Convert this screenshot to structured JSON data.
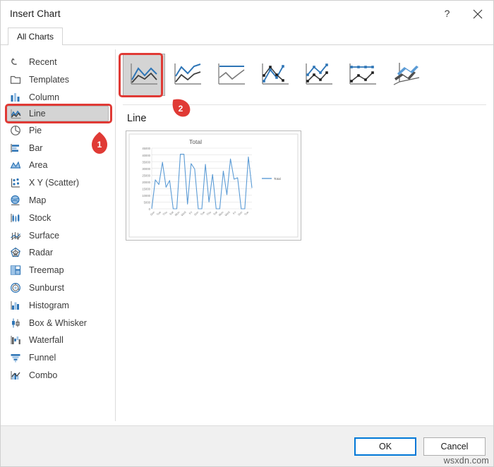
{
  "window": {
    "title": "Insert Chart",
    "help_button": "?",
    "close_button": "✕",
    "help_icon": "help-icon",
    "close_icon": "close-icon"
  },
  "tabs": [
    {
      "label": "All Charts",
      "selected": true
    }
  ],
  "sidebar": {
    "items": [
      {
        "label": "Recent",
        "icon": "recent-icon",
        "selected": false
      },
      {
        "label": "Templates",
        "icon": "templates-icon",
        "selected": false
      },
      {
        "label": "Column",
        "icon": "column-chart-icon",
        "selected": false
      },
      {
        "label": "Line",
        "icon": "line-chart-icon",
        "selected": true
      },
      {
        "label": "Pie",
        "icon": "pie-chart-icon",
        "selected": false
      },
      {
        "label": "Bar",
        "icon": "bar-chart-icon",
        "selected": false
      },
      {
        "label": "Area",
        "icon": "area-chart-icon",
        "selected": false
      },
      {
        "label": "X Y (Scatter)",
        "icon": "scatter-chart-icon",
        "selected": false
      },
      {
        "label": "Map",
        "icon": "map-chart-icon",
        "selected": false
      },
      {
        "label": "Stock",
        "icon": "stock-chart-icon",
        "selected": false
      },
      {
        "label": "Surface",
        "icon": "surface-chart-icon",
        "selected": false
      },
      {
        "label": "Radar",
        "icon": "radar-chart-icon",
        "selected": false
      },
      {
        "label": "Treemap",
        "icon": "treemap-chart-icon",
        "selected": false
      },
      {
        "label": "Sunburst",
        "icon": "sunburst-chart-icon",
        "selected": false
      },
      {
        "label": "Histogram",
        "icon": "histogram-chart-icon",
        "selected": false
      },
      {
        "label": "Box & Whisker",
        "icon": "box-whisker-icon",
        "selected": false
      },
      {
        "label": "Waterfall",
        "icon": "waterfall-chart-icon",
        "selected": false
      },
      {
        "label": "Funnel",
        "icon": "funnel-chart-icon",
        "selected": false
      },
      {
        "label": "Combo",
        "icon": "combo-chart-icon",
        "selected": false
      }
    ]
  },
  "main": {
    "type_heading": "Line",
    "thumbnails": [
      {
        "name": "line",
        "selected": true
      },
      {
        "name": "stacked-line",
        "selected": false
      },
      {
        "name": "100-percent-stacked-line",
        "selected": false
      },
      {
        "name": "line-with-markers",
        "selected": false
      },
      {
        "name": "stacked-line-with-markers",
        "selected": false
      },
      {
        "name": "100-percent-stacked-line-with-markers",
        "selected": false
      },
      {
        "name": "3-d-line",
        "selected": false
      }
    ]
  },
  "footer": {
    "ok_label": "OK",
    "cancel_label": "Cancel",
    "watermark": "wsxdn.com"
  },
  "annotations": [
    {
      "number": "1",
      "target": "sidebar-item-line"
    },
    {
      "number": "2",
      "target": "thumbnail-line"
    }
  ],
  "chart_data": {
    "type": "line",
    "title": "Total",
    "xlabel": "",
    "ylabel": "",
    "ylim": [
      0,
      45000
    ],
    "yticks": [
      0,
      5000,
      10000,
      15000,
      20000,
      25000,
      30000,
      35000,
      40000,
      45000
    ],
    "ytick_labels": [
      "0",
      "5000",
      "10000",
      "15000",
      "20000",
      "25000",
      "30000",
      "35000",
      "40000",
      "45000"
    ],
    "grid": true,
    "legend": [
      "Total"
    ],
    "legend_position": "right",
    "line_color": "#5b9bd5",
    "categories": [
      "Sun",
      "Mon",
      "Tue",
      "Wed",
      "Thu",
      "Fri",
      "Sat",
      "Sun",
      "Mon",
      "Tue",
      "Wed",
      "Thu",
      "Fri",
      "Sat",
      "Sun",
      "Mon",
      "Tue",
      "Wed",
      "Thu",
      "Fri",
      "Sat",
      "Sun",
      "Mon",
      "Tue",
      "Wed",
      "Thu",
      "Fri",
      "Sat",
      "Sun",
      "Mon",
      "Tue",
      "Wed"
    ],
    "tick_labels": [
      "Sun",
      "Tue",
      "Thu",
      "Sat",
      "Mon",
      "Wed",
      "Fri",
      "Sun",
      "Tue",
      "Thu",
      "Sat",
      "Mon",
      "Wed",
      "Fri",
      "Sun",
      "Tue"
    ],
    "series": [
      {
        "name": "Total",
        "values": [
          0,
          21500,
          18000,
          34500,
          16000,
          21000,
          0,
          0,
          40500,
          40500,
          3500,
          33500,
          29500,
          0,
          0,
          33000,
          5000,
          25500,
          0,
          0,
          28000,
          10500,
          37000,
          22000,
          23000,
          0,
          0,
          38500,
          15500
        ]
      }
    ]
  }
}
